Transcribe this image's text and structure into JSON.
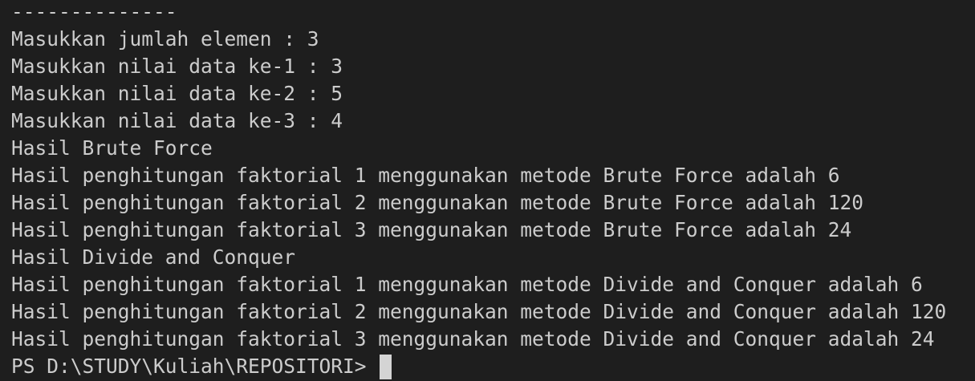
{
  "terminal": {
    "lines": [
      "--------------",
      "Masukkan jumlah elemen : 3",
      "Masukkan nilai data ke-1 : 3",
      "Masukkan nilai data ke-2 : 5",
      "Masukkan nilai data ke-3 : 4",
      "Hasil Brute Force",
      "Hasil penghitungan faktorial 1 menggunakan metode Brute Force adalah 6",
      "Hasil penghitungan faktorial 2 menggunakan metode Brute Force adalah 120",
      "Hasil penghitungan faktorial 3 menggunakan metode Brute Force adalah 24",
      "Hasil Divide and Conquer",
      "Hasil penghitungan faktorial 1 menggunakan metode Divide and Conquer adalah 6",
      "Hasil penghitungan faktorial 2 menggunakan metode Divide and Conquer adalah 120",
      "Hasil penghitungan faktorial 3 menggunakan metode Divide and Conquer adalah 24"
    ],
    "prompt": "PS D:\\STUDY\\Kuliah\\REPOSITORI>",
    "background_color": "#1e1e1e",
    "text_color": "#cccccc"
  }
}
